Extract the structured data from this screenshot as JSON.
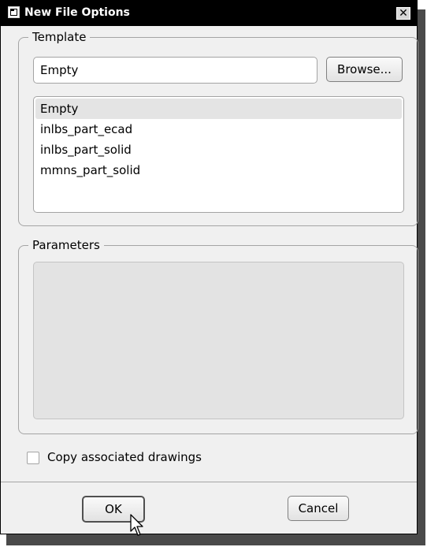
{
  "window": {
    "title": "New File Options",
    "close_glyph": "✕"
  },
  "template_group": {
    "legend": "Template",
    "field_value": "Empty",
    "browse_label": "Browse...",
    "items": [
      {
        "label": "Empty",
        "selected": true
      },
      {
        "label": "inlbs_part_ecad",
        "selected": false
      },
      {
        "label": "inlbs_part_solid",
        "selected": false
      },
      {
        "label": "mmns_part_solid",
        "selected": false
      }
    ]
  },
  "parameters_group": {
    "legend": "Parameters"
  },
  "copy_drawings": {
    "label": "Copy associated drawings",
    "checked": false
  },
  "buttons": {
    "ok_label": "OK",
    "cancel_label": "Cancel"
  },
  "icons": {
    "window_icon": "window-icon",
    "close": "close-icon",
    "cursor": "mouse-pointer-icon"
  }
}
